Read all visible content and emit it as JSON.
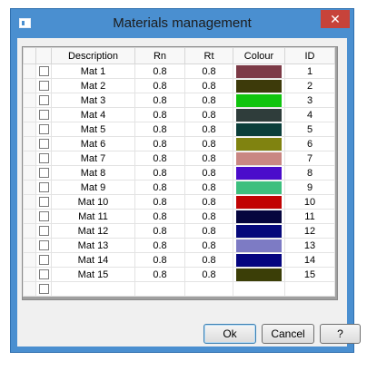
{
  "window": {
    "title": "Materials management",
    "close_glyph": "✕"
  },
  "table": {
    "columns": [
      "Description",
      "Rn",
      "Rt",
      "Colour",
      "ID"
    ],
    "rows": [
      {
        "desc": "Mat 1",
        "rn": "0.8",
        "rt": "0.8",
        "colour": "#7c3a46",
        "id": "1"
      },
      {
        "desc": "Mat 2",
        "rn": "0.8",
        "rt": "0.8",
        "colour": "#3d3a0a",
        "id": "2"
      },
      {
        "desc": "Mat 3",
        "rn": "0.8",
        "rt": "0.8",
        "colour": "#10c40e",
        "id": "3"
      },
      {
        "desc": "Mat 4",
        "rn": "0.8",
        "rt": "0.8",
        "colour": "#2f3d3b",
        "id": "4"
      },
      {
        "desc": "Mat 5",
        "rn": "0.8",
        "rt": "0.8",
        "colour": "#0b3e3a",
        "id": "5"
      },
      {
        "desc": "Mat 6",
        "rn": "0.8",
        "rt": "0.8",
        "colour": "#808310",
        "id": "6"
      },
      {
        "desc": "Mat 7",
        "rn": "0.8",
        "rt": "0.8",
        "colour": "#c98783",
        "id": "7"
      },
      {
        "desc": "Mat 8",
        "rn": "0.8",
        "rt": "0.8",
        "colour": "#4a0ccb",
        "id": "8"
      },
      {
        "desc": "Mat 9",
        "rn": "0.8",
        "rt": "0.8",
        "colour": "#3dbf7e",
        "id": "9"
      },
      {
        "desc": "Mat 10",
        "rn": "0.8",
        "rt": "0.8",
        "colour": "#c10303",
        "id": "10"
      },
      {
        "desc": "Mat 11",
        "rn": "0.8",
        "rt": "0.8",
        "colour": "#05053e",
        "id": "11"
      },
      {
        "desc": "Mat 12",
        "rn": "0.8",
        "rt": "0.8",
        "colour": "#05087b",
        "id": "12"
      },
      {
        "desc": "Mat 13",
        "rn": "0.8",
        "rt": "0.8",
        "colour": "#7d7bc4",
        "id": "13"
      },
      {
        "desc": "Mat 14",
        "rn": "0.8",
        "rt": "0.8",
        "colour": "#04047f",
        "id": "14"
      },
      {
        "desc": "Mat 15",
        "rn": "0.8",
        "rt": "0.8",
        "colour": "#3b3e07",
        "id": "15"
      }
    ]
  },
  "buttons": {
    "ok": "Ok",
    "cancel": "Cancel",
    "help": "?"
  }
}
